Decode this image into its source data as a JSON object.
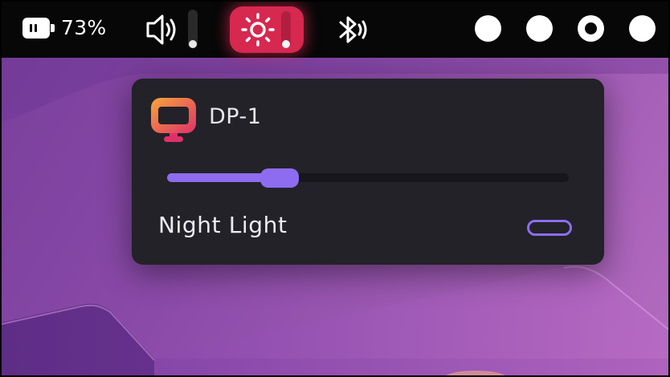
{
  "topbar": {
    "battery": {
      "icon": "battery-icon",
      "percent_text": "73%"
    },
    "volume": {
      "icon": "speaker-icon",
      "level": 0.05
    },
    "brightness": {
      "icon": "sun-icon",
      "level": 0.05,
      "active_color": "#d7284f"
    },
    "bluetooth": {
      "icon": "bluetooth-icon"
    },
    "workspaces": [
      {
        "id": 1,
        "active": false
      },
      {
        "id": 2,
        "active": false
      },
      {
        "id": 3,
        "active": true
      },
      {
        "id": 4,
        "active": false
      }
    ]
  },
  "popup": {
    "display_name": "DP-1",
    "icon": "monitor-icon",
    "brightness_level": 0.28,
    "night_light": {
      "label": "Night Light",
      "enabled": false
    },
    "accent_color": "#8e6cf0",
    "background_color": "#232228"
  }
}
